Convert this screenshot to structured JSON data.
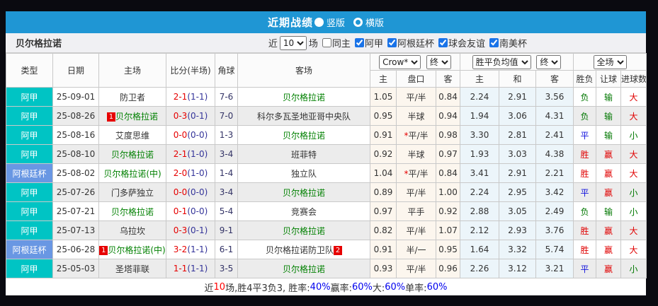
{
  "title_bar": {
    "title": "近期战绩",
    "radio_vertical": "竖版",
    "radio_horizontal": "横版",
    "vertical_selected": true
  },
  "filter_bar": {
    "team_name": "贝尔格拉诺",
    "recent_label": "近",
    "recent_count": "10",
    "matches_label": "场",
    "checkboxes": [
      {
        "label": "同主",
        "checked": false
      },
      {
        "label": "阿甲",
        "checked": true
      },
      {
        "label": "阿根廷杯",
        "checked": true
      },
      {
        "label": "球会友谊",
        "checked": true
      },
      {
        "label": "南美杯",
        "checked": true
      }
    ]
  },
  "table": {
    "header": {
      "type": "类型",
      "date": "日期",
      "home": "主场",
      "score": "比分(半场)",
      "corner": "角球",
      "away": "客场",
      "odds_dropdown": "Crow*",
      "odds_final": "终",
      "wdl_dropdown": "胜平负均值",
      "wdl_final": "终",
      "fullmatch_dropdown": "全场",
      "odds_home": "主",
      "odds_handicap": "盘口",
      "odds_away": "客",
      "wdl_home": "主",
      "wdl_draw": "和",
      "wdl_away": "客",
      "result_wl": "胜负",
      "result_handicap": "让球",
      "result_goals": "进球数"
    },
    "rows": [
      {
        "type": "阿甲",
        "date": "25-09-01",
        "home": {
          "name": "防卫者",
          "focus": false,
          "card": ""
        },
        "score": "2-1",
        "half": "(1-1)",
        "corner": "7-6",
        "away": {
          "name": "贝尔格拉诺",
          "focus": true,
          "card": ""
        },
        "crown": [
          "1.05",
          "平/半",
          "0.84"
        ],
        "wdl": [
          "2.24",
          "2.91",
          "3.56"
        ],
        "result": [
          "负",
          "输",
          "大"
        ]
      },
      {
        "type": "阿甲",
        "date": "25-08-26",
        "home": {
          "name": "贝尔格拉诺",
          "focus": true,
          "card": "1"
        },
        "score": "0-3",
        "half": "(0-1)",
        "corner": "7-0",
        "away": {
          "name": "科尔多瓦圣地亚哥中央队",
          "focus": false,
          "card": ""
        },
        "crown": [
          "0.95",
          "半球",
          "0.94"
        ],
        "wdl": [
          "1.94",
          "3.06",
          "4.31"
        ],
        "result": [
          "负",
          "输",
          "大"
        ]
      },
      {
        "type": "阿甲",
        "date": "25-08-16",
        "home": {
          "name": "艾度思维",
          "focus": false,
          "card": ""
        },
        "score": "0-0",
        "half": "(0-0)",
        "corner": "1-3",
        "away": {
          "name": "贝尔格拉诺",
          "focus": true,
          "card": ""
        },
        "crown": [
          "0.91",
          "*平/半",
          "0.98"
        ],
        "wdl": [
          "3.30",
          "2.81",
          "2.41"
        ],
        "result": [
          "平",
          "输",
          "小"
        ]
      },
      {
        "type": "阿甲",
        "date": "25-08-10",
        "home": {
          "name": "贝尔格拉诺",
          "focus": true,
          "card": ""
        },
        "score": "2-1",
        "half": "(1-0)",
        "corner": "3-4",
        "away": {
          "name": "班菲特",
          "focus": false,
          "card": ""
        },
        "crown": [
          "0.92",
          "半球",
          "0.97"
        ],
        "wdl": [
          "1.93",
          "3.03",
          "4.38"
        ],
        "result": [
          "胜",
          "赢",
          "大"
        ]
      },
      {
        "type": "阿根廷杯",
        "date": "25-08-02",
        "home": {
          "name": "贝尔格拉诺(中)",
          "focus": true,
          "card": ""
        },
        "score": "2-0",
        "half": "(1-0)",
        "corner": "1-4",
        "away": {
          "name": "独立队",
          "focus": false,
          "card": ""
        },
        "crown": [
          "1.04",
          "*平/半",
          "0.84"
        ],
        "wdl": [
          "3.41",
          "2.91",
          "2.21"
        ],
        "result": [
          "胜",
          "赢",
          "大"
        ]
      },
      {
        "type": "阿甲",
        "date": "25-07-26",
        "home": {
          "name": "门多萨独立",
          "focus": false,
          "card": ""
        },
        "score": "0-0",
        "half": "(0-0)",
        "corner": "3-4",
        "away": {
          "name": "贝尔格拉诺",
          "focus": true,
          "card": ""
        },
        "crown": [
          "0.89",
          "平/半",
          "1.00"
        ],
        "wdl": [
          "2.24",
          "2.95",
          "3.42"
        ],
        "result": [
          "平",
          "赢",
          "小"
        ]
      },
      {
        "type": "阿甲",
        "date": "25-07-21",
        "home": {
          "name": "贝尔格拉诺",
          "focus": true,
          "card": ""
        },
        "score": "0-1",
        "half": "(0-0)",
        "corner": "5-4",
        "away": {
          "name": "竞赛会",
          "focus": false,
          "card": ""
        },
        "crown": [
          "0.97",
          "平手",
          "0.92"
        ],
        "wdl": [
          "2.88",
          "3.05",
          "2.49"
        ],
        "result": [
          "负",
          "输",
          "小"
        ]
      },
      {
        "type": "阿甲",
        "date": "25-07-13",
        "home": {
          "name": "乌拉坎",
          "focus": false,
          "card": ""
        },
        "score": "0-3",
        "half": "(0-1)",
        "corner": "9-1",
        "away": {
          "name": "贝尔格拉诺",
          "focus": true,
          "card": ""
        },
        "crown": [
          "0.82",
          "平/半",
          "1.07"
        ],
        "wdl": [
          "2.12",
          "2.93",
          "3.76"
        ],
        "result": [
          "胜",
          "赢",
          "大"
        ]
      },
      {
        "type": "阿根廷杯",
        "date": "25-06-28",
        "home": {
          "name": "贝尔格拉诺(中)",
          "focus": true,
          "card": "1"
        },
        "score": "3-2",
        "half": "(1-1)",
        "corner": "6-1",
        "away": {
          "name": "贝尔格拉诺防卫队",
          "focus": false,
          "card": "2"
        },
        "crown": [
          "0.91",
          "半/一",
          "0.95"
        ],
        "wdl": [
          "1.64",
          "3.32",
          "5.74"
        ],
        "result": [
          "胜",
          "赢",
          "大"
        ]
      },
      {
        "type": "阿甲",
        "date": "25-05-03",
        "home": {
          "name": "圣塔菲联",
          "focus": false,
          "card": ""
        },
        "score": "1-1",
        "half": "(1-1)",
        "corner": "3-5",
        "away": {
          "name": "贝尔格拉诺",
          "focus": true,
          "card": ""
        },
        "crown": [
          "0.93",
          "平/半",
          "0.96"
        ],
        "wdl": [
          "2.26",
          "3.12",
          "3.21"
        ],
        "result": [
          "平",
          "赢",
          "小"
        ]
      }
    ]
  },
  "summary": {
    "segments": [
      {
        "text": "近",
        "color": "#333333"
      },
      {
        "text": "10",
        "color": "#ff0000"
      },
      {
        "text": "场,胜4平3负3, 胜率:",
        "color": "#333333"
      },
      {
        "text": "40%",
        "color": "#0000ee"
      },
      {
        "text": " 赢率:",
        "color": "#333333"
      },
      {
        "text": "60%",
        "color": "#0000ee"
      },
      {
        "text": " 大:",
        "color": "#333333"
      },
      {
        "text": "60%",
        "color": "#0000ee"
      },
      {
        "text": " 单率:",
        "color": "#333333"
      },
      {
        "text": "60%",
        "color": "#0000ee"
      }
    ]
  },
  "colors": {
    "title_bar": "#1f96d4",
    "type_badge": {
      "阿甲": "#00c4c4",
      "阿根廷杯": "#6997e3"
    },
    "result_map": {
      "胜": "#e00000",
      "平": "#1010dd",
      "负": "#007700",
      "赢": "#e00000",
      "输": "#007700",
      "大": "#e00000",
      "小": "#007700"
    },
    "focus_team": "#008000",
    "other_team": "#333333",
    "score": "#e60000",
    "half_score": "#333399",
    "card_badge": "#e60000"
  }
}
